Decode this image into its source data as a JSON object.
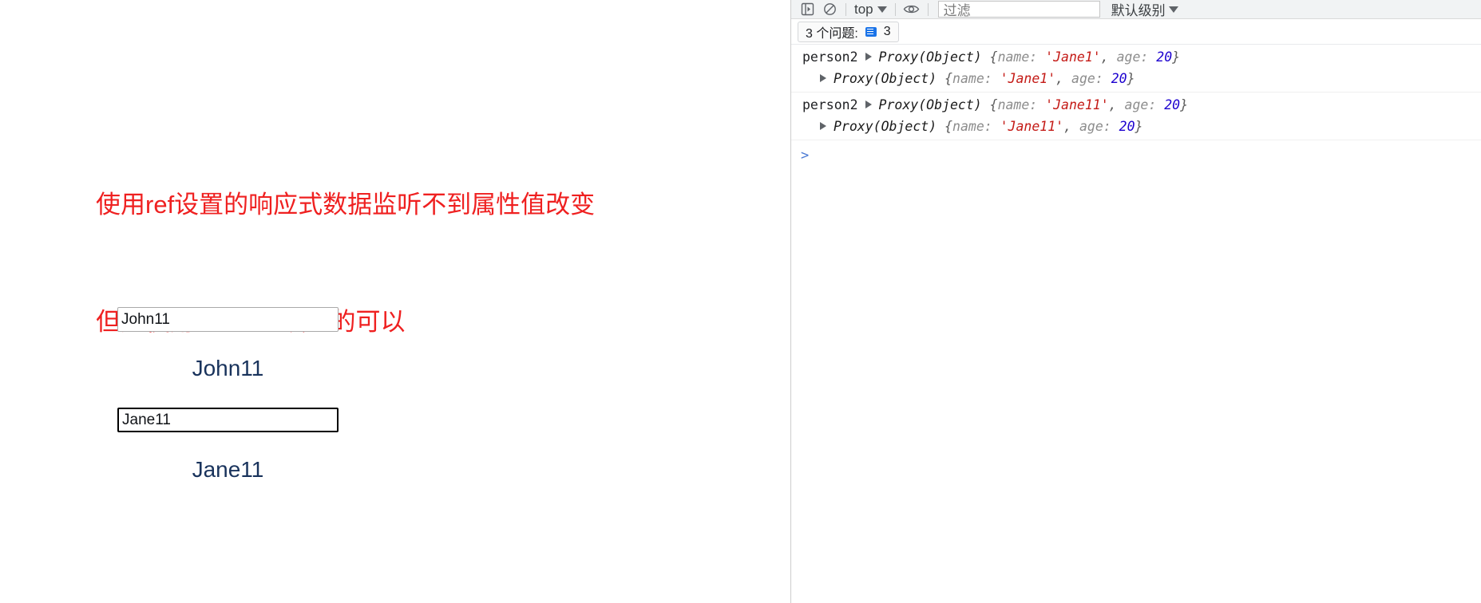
{
  "page": {
    "notice_line1": "使用ref设置的响应式数据监听不到属性值改变",
    "notice_line2": "但是使用reactive设置的可以",
    "notice_color": "#ef2020",
    "fields": [
      {
        "name": "name1",
        "value": "John11",
        "echo": "John11",
        "focused": false
      },
      {
        "name": "name2",
        "value": "Jane11",
        "echo": "Jane11",
        "focused": true
      }
    ],
    "echo_color": "#19335c"
  },
  "devtools": {
    "toolbar": {
      "sidebar_toggle_icon": "sidebar-toggle-icon",
      "clear_console_icon": "clear-console-icon",
      "context_label": "top",
      "context_caret_icon": "chevron-down-icon",
      "live_expression_icon": "eye-icon",
      "filter_placeholder": "过滤",
      "filter_value": "",
      "level_label": "默认级别",
      "level_caret_icon": "chevron-down-icon"
    },
    "issues": {
      "label": "3 个问题:",
      "badge_icon": "issues-message-icon",
      "count": "3",
      "badge_color": "#1a73e8"
    },
    "log_groups": [
      {
        "label": "person2",
        "expand_icon": "disclosure-triangle-icon",
        "type": "Proxy(Object)",
        "open_brace": " {",
        "key_name": "name:",
        "value_name": "'Jane1'",
        "comma": ", ",
        "key_age": "age:",
        "value_age": "20",
        "close_brace": "}",
        "nested": {
          "expand_icon": "disclosure-triangle-icon",
          "type": "Proxy(Object)",
          "open_brace": " {",
          "key_name": "name:",
          "value_name": "'Jane1'",
          "comma": ", ",
          "key_age": "age:",
          "value_age": "20",
          "close_brace": "}"
        }
      },
      {
        "label": "person2",
        "expand_icon": "disclosure-triangle-icon",
        "type": "Proxy(Object)",
        "open_brace": " {",
        "key_name": "name:",
        "value_name": "'Jane11'",
        "comma": ", ",
        "key_age": "age:",
        "value_age": "20",
        "close_brace": "}",
        "nested": {
          "expand_icon": "disclosure-triangle-icon",
          "type": "Proxy(Object)",
          "open_brace": " {",
          "key_name": "name:",
          "value_name": "'Jane11'",
          "comma": ", ",
          "key_age": "age:",
          "value_age": "20",
          "close_brace": "}"
        }
      }
    ],
    "prompt": {
      "caret": ">",
      "value": ""
    }
  }
}
